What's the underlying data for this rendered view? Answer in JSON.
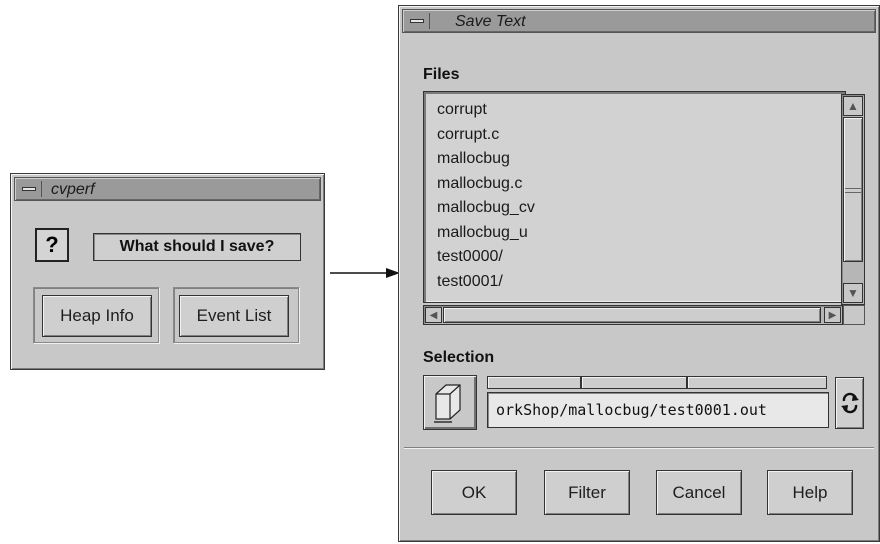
{
  "cvperf": {
    "title": "cvperf",
    "question_icon": "?",
    "prompt": "What should I save?",
    "buttons": {
      "heap_info": "Heap Info",
      "event_list": "Event List"
    }
  },
  "save_text": {
    "title": "Save Text",
    "files_label": "Files",
    "files": [
      "corrupt",
      "corrupt.c",
      "mallocbug",
      "mallocbug.c",
      "mallocbug_cv",
      "mallocbug_u",
      "test0000/",
      "test0001/"
    ],
    "selection_label": "Selection",
    "selection_value": "orkShop/mallocbug/test0001.out",
    "buttons": {
      "ok": "OK",
      "filter": "Filter",
      "cancel": "Cancel",
      "help": "Help"
    }
  },
  "icons": {
    "window_menu": "window-menu-icon",
    "question": "question-icon",
    "folder": "folder-icon",
    "refresh": "refresh-icon",
    "arrow": "right-arrow-icon"
  }
}
